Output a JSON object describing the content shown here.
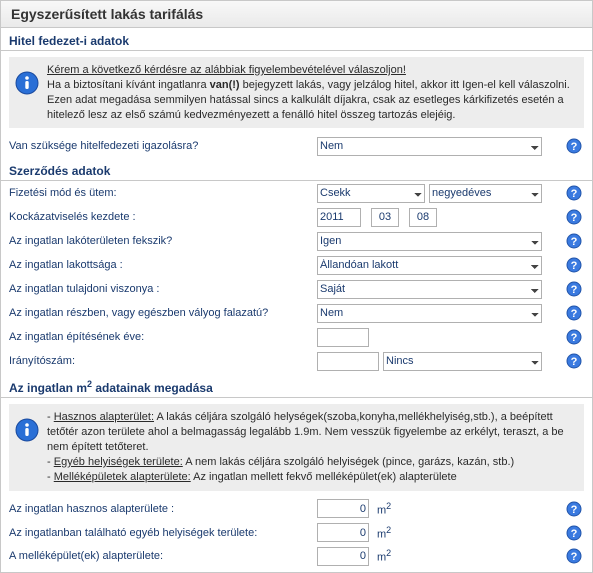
{
  "panel_title": "Egyszerűsített lakás tarifálás",
  "sections": {
    "s1": "Hitel fedezet-i adatok",
    "s2": "Szerződés adatok",
    "s3_pre": "Az ingatlan m",
    "s3_sup": "2",
    "s3_post": " adatainak megadása"
  },
  "info1": {
    "headline": "Kérem a következő kérdésre az alábbiak figyelembevételével válaszoljon!",
    "p1a": "Ha a biztosítani kívánt ingatlanra ",
    "p1b": "van(!)",
    "p1c": " bejegyzett lakás, vagy jelzálog hitel, akkor itt Igen-el kell válaszolni. Ezen adat megadása semmilyen hatással sincs a kalkulált díjakra, csak az esetleges kárkifizetés esetén a hitelező lesz az első számú kedvezményezett a fenálló hitel összeg tartozás elejéig."
  },
  "info2": {
    "l1u": "Hasznos alapterület:",
    "l1": " A lakás céljára szolgáló helységek(szoba,konyha,mellékhelyiség,stb.), a beépített tetőtér azon területe ahol a belmagasság legalább 1.9m. Nem vesszük figyelembe az erkélyt, teraszt, a be nem épített tetőteret.",
    "l2u": "Egyéb helyiségek területe:",
    "l2": " A nem lakás céljára szolgáló helyiségek (pince, garázs, kazán, stb.)",
    "l3u": "Melléképületek alapterülete:",
    "l3": " Az ingatlan mellett fekvő melléképület(ek) alapterülete"
  },
  "rows": {
    "r1": "Van szüksége hitelfedezeti igazolásra?",
    "r2": "Fizetési mód és ütem:",
    "r3": "Kockázatviselés kezdete :",
    "r4": "Az ingatlan lakóterületen fekszik?",
    "r5": "Az ingatlan lakottsága :",
    "r6": "Az ingatlan tulajdoni viszonya :",
    "r7": "Az ingatlan részben, vagy egészben vályog falazatú?",
    "r8": "Az ingatlan építésének éve:",
    "r9": "Irányítószám:",
    "r10": "Az ingatlan hasznos alapterülete :",
    "r11": "Az ingatlanban található egyéb helyiségek területe:",
    "r12": "A melléképület(ek) alapterülete:"
  },
  "values": {
    "v1": "Nem",
    "v2a": "Csekk",
    "v2b": "negyedéves",
    "v3y": "2011",
    "v3m": "03",
    "v3d": "08",
    "v4": "Igen",
    "v5": "Állandóan lakott",
    "v6": "Saját",
    "v7": "Nem",
    "v8": "",
    "v9a": "",
    "v9b": "Nincs",
    "v10": "0",
    "v11": "0",
    "v12": "0"
  },
  "unit_m": "m",
  "unit_2": "2",
  "dash": "- ",
  "dot": "."
}
